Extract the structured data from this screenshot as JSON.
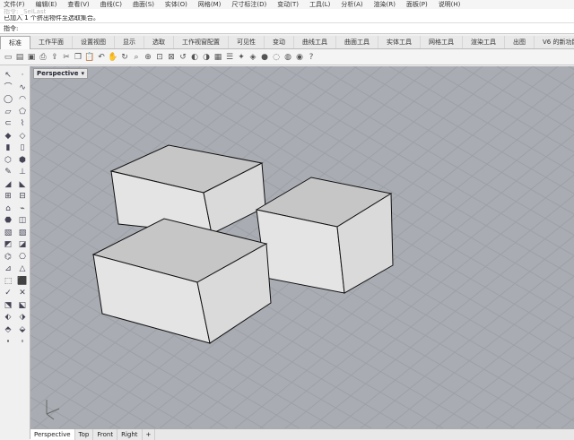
{
  "menu": [
    "文件(F)",
    "编辑(E)",
    "查看(V)",
    "曲线(C)",
    "曲面(S)",
    "实体(O)",
    "网格(M)",
    "尺寸标注(D)",
    "变动(T)",
    "工具(L)",
    "分析(A)",
    "渲染(R)",
    "面板(P)",
    "说明(H)"
  ],
  "command_history": {
    "line1": "已加入 1 个挤出物件至选取集合。",
    "faded": "指令: _SelLast"
  },
  "command_prompt": "指令:",
  "tabs": [
    {
      "label": "标准",
      "active": true
    },
    {
      "label": "工作平面"
    },
    {
      "label": "设置视图"
    },
    {
      "label": "显示"
    },
    {
      "label": "选取"
    },
    {
      "label": "工作视窗配置"
    },
    {
      "label": "可见性"
    },
    {
      "label": "变动"
    },
    {
      "label": "曲线工具"
    },
    {
      "label": "曲面工具"
    },
    {
      "label": "实体工具"
    },
    {
      "label": "网格工具"
    },
    {
      "label": "渲染工具"
    },
    {
      "label": "出图"
    },
    {
      "label": "V6 的新功能"
    }
  ],
  "toolbar_icons": [
    "new",
    "open",
    "save",
    "print",
    "import",
    "cut",
    "copy",
    "paste",
    "undo",
    "pan",
    "rotate",
    "zoom-window",
    "zoom-dynamic",
    "zoom-extents",
    "zoom-selected",
    "undo-view",
    "shade",
    "render",
    "named-view",
    "properties",
    "lights",
    "materials",
    "rendered-ball",
    "ghosted-ball",
    "xray-ball",
    "technical-ball",
    "help"
  ],
  "sidebar_icons": 46,
  "viewport": {
    "title": "Perspective",
    "dropdown": "▾",
    "background": "#a9adb3",
    "grid_color": "#9da1a7",
    "box_top": "#c6c6c6",
    "box_side": "#e4e4e4",
    "box_edge": "#111111"
  },
  "viewport_tabs": [
    {
      "label": "Perspective",
      "active": true
    },
    {
      "label": "Top"
    },
    {
      "label": "Front"
    },
    {
      "label": "Right"
    },
    {
      "label": "+"
    }
  ]
}
